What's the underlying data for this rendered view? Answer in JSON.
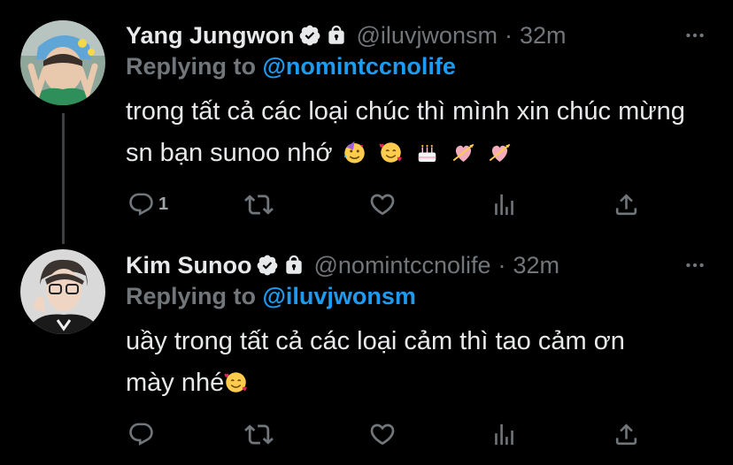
{
  "colors": {
    "background": "#000000",
    "text": "#e7e9ea",
    "muted": "#71767b",
    "link": "#1d9bf0",
    "thread_line": "#3e4144"
  },
  "tweets": [
    {
      "display_name": "Yang Jungwon",
      "handle": "@iluvjwonsm",
      "separator": "·",
      "time": "32m",
      "replying_prefix": "Replying to",
      "replying_to": "@nomintccnolife",
      "text": "trong tất cả các loại chúc thì mình xin chúc mừng sn bạn sunoo nhớ",
      "emojis": [
        "partying-face",
        "smiling-face-with-hearts",
        "birthday-cake",
        "heart-with-arrow",
        "heart-with-arrow"
      ],
      "reply_count": "1",
      "icons": [
        "verified-badge-icon",
        "lock-icon",
        "more-icon",
        "reply-icon",
        "retweet-icon",
        "like-icon",
        "analytics-icon",
        "share-icon"
      ]
    },
    {
      "display_name": "Kim Sunoo",
      "handle": "@nomintccnolife",
      "separator": "·",
      "time": "32m",
      "replying_prefix": "Replying to",
      "replying_to": "@iluvjwonsm",
      "text_line1": "uầy trong tất cả các loại cảm thì tao cảm ơn",
      "text_line2": "mày nhé",
      "emojis": [
        "smiling-face-with-hearts"
      ],
      "reply_count": "",
      "icons": [
        "verified-badge-icon",
        "lock-icon",
        "more-icon",
        "reply-icon",
        "retweet-icon",
        "like-icon",
        "analytics-icon",
        "share-icon"
      ]
    }
  ]
}
